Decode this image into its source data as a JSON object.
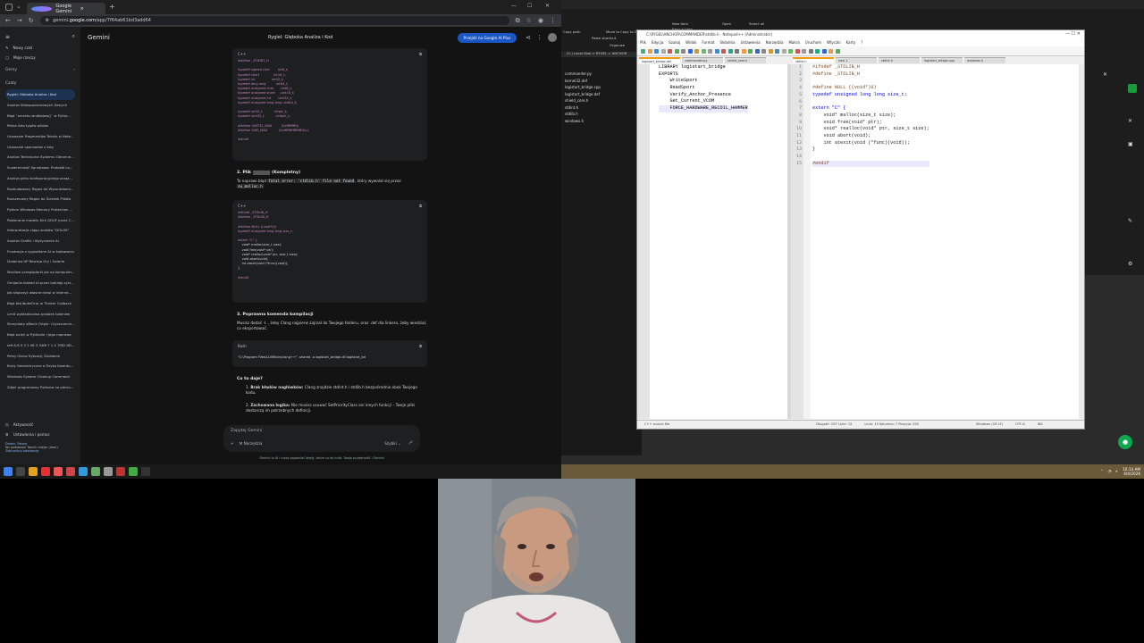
{
  "browser": {
    "tab_title": "Google Gemini",
    "url_plain": "gemini.",
    "url_bold": "google.com",
    "url_rest": "/app/7f64ab61bd3add64"
  },
  "gemini": {
    "brand": "Gemini",
    "conversation_title": "Ryglel: Głęboka Analiza i Kod",
    "upgrade_label": "Przejdź na Google AI Plus",
    "sidebar": {
      "new_chat": "Nowy czat",
      "my_stuff": "Moje rzeczy",
      "gems_heading": "Gemy",
      "chats_heading": "Czaty",
      "chats": [
        "Ryglel: Głęboka Analiza i Kod",
        "Analiza Wielopoziomowych Danych",
        "Błąd `secrets.randbelow()` w Pytho...",
        "Petna lista typów plików",
        "Usuwanie Fragmentów Tekstu w Note...",
        "Usuwanie sponsorów z listy",
        "Analiza Techniczna Systemu Obronne...",
        "Suwerenność Sprzętowa: Protokół Lo...",
        "Analiza pliku konfiguracyjnego prząż...",
        "Rozbudowany Regex do Wyszukiwani...",
        "Rozszerzony Regex do Ścieżek Plików",
        "Python Windows Memory Protection ...",
        "Pobieranie modelu Kirk GGUF przez C...",
        "Interpretacja ciągu znaków \"DOLOK\"",
        "Analiza Grafiki i Wytyczenie AI",
        "Frustracja z sygnatiami AI w kodowaniu",
        "Drabinka HP Rewizja Gry i Galerie",
        "Możliwe przeglądarki jak na komputer...",
        "Omijanie blokad AI przez lodułęp sysl...",
        "Jak stworzyć własne drzwi w interne...",
        "Błąd AttributeError w Tkinter Callback",
        "Limit wykładnictwa prośbek tokenów",
        "Skrzydlaty xBlock Origin: Czyszczenie...",
        "Błąd wcięć w Pythonie i jego naprawa",
        "Ieft 8-8 9 3 2 06 3 34f8 7 1 4 7f5D 6D...",
        "Pełny Obraz Sytuacji, Działanie",
        "Bryły Geometryczne a Fizyka Kwantu...",
        "Windows System Cleanup Command",
        "Zdjęć programowy Pythona na plecia..."
      ],
      "activity": "Aktywność",
      "settings": "Ustawienia i pomoc",
      "location_line1": "Drobin, Polska",
      "location_line2": "Na podstawie Twoich miejsc (dom)",
      "location_line3": "Zaktualizuj lokalizację"
    },
    "code1_lang": "C++",
    "code1_lines": [
      "#define _STDINT_H",
      "",
      "typedef signed char        int8_t;",
      "typedef short              int16_t;",
      "typedef int                int32_t;",
      "typedef long long          int64_t;",
      "typedef unsigned char      uint8_t;",
      "typedef unsigned short     uint16_t;",
      "typedef unsigned int       uint32_t;",
      "typedef unsigned long long uint64_t;",
      "",
      "typedef int32_t            intptr_t;",
      "typedef uint32_t           uintptr_t;",
      "",
      "#define UINT32_MAX         (0xffffffffU)",
      "#define SIZE_MAX           (0xffffffffffffffffULL)",
      "",
      "#endif"
    ],
    "step2_prefix": "2. Plik",
    "step2_suffix": "(Kompletny)",
    "step2_text_a": "To naprawi błąd",
    "step2_code_a": "fatal error: 'stdlib.h' file not found",
    "step2_text_b": ", który wywalał się przez",
    "step2_code_b": "sw_malloc.h",
    "code2_lang": "C++",
    "code2_lines": [
      "#ifndef _STDLIB_H",
      "#define _STDLIB_H",
      "",
      "#define NULL ((void*)0)",
      "typedef unsigned long long size_t;",
      "",
      "extern \"C\" {",
      "    void* malloc(size_t size);",
      "    void free(void* ptr);",
      "    void* realloc(void* ptr, size_t size);",
      "    void abort(void);",
      "    int atexit(void (*func)(void));",
      "}",
      "",
      "#endif"
    ],
    "step3_heading": "3. Poprawna komenda kompilacji",
    "step3_text": "Musisz dodać -I. , żeby Clang najpierw zajrzał do Twojego folderu, oraz .def dla linkera, żeby wiedział, co eksportować.",
    "code3_lang": "Bash",
    "code3_line": "\"C:\\Program Files\\LLVM\\bin\\clang++\" -shared -o logistart_bridge.dll logistart_bri",
    "result_heading": "Co to daje?",
    "result_1_bold": "Brak błędów nagłówków:",
    "result_1_text": " Clang znajdzie stdint.h i stdlib.h bezpośrednio obok Twojego kodu.",
    "result_2_bold": "Zachowana logika:",
    "result_2_text": " Nie musisz usuwać SetPriorityClass ani innych funkcji – Twoje pliki dostarczą im potrzebnych definicji.",
    "prompt_placeholder": "Zapytaj Gemini",
    "tools_label": "Narzędzia",
    "mode_label": "Szybki",
    "disclaimer": "Gemini to AI i może popełniać błędy, także co do ludzi. Twoja prywatność i Gemini"
  },
  "explorer": {
    "buttons": [
      "Copy path",
      "Paste shortcut",
      "Move to",
      "Copy to",
      "Delete",
      "Rename",
      "New item",
      "Easy access",
      "Open",
      "Select all"
    ],
    "group_label": "Organize",
    "path": "(C:) Local Disk  >  RYGEL  >  ANCHOR",
    "files": [
      "commander.py",
      "kernel32.def",
      "logistart_bridge.cpp",
      "logistart_bridge.def",
      "shield_core.h",
      "stdint.h",
      "stdlib.h",
      "windows.h"
    ]
  },
  "notepadpp": {
    "title": "C:\\RYGEL\\ANCHOR\\COMMANDER\\stdlib.h - Notepad++ [Administrator]",
    "menu": [
      "Plik",
      "Edycja",
      "Szukaj",
      "Widok",
      "Format",
      "Składnia",
      "Ustawienia",
      "Narzędzia",
      "Makra",
      "Uruchom",
      "Wtyczki",
      "Karty",
      "?"
    ],
    "left_tabs": [
      "logistart_bridge.def",
      "commander.py",
      "shield_core.h"
    ],
    "right_tabs": [
      "stdlib.h",
      "new 1",
      "stdint.h",
      "logistart_bridge.cpp",
      "windows.h"
    ],
    "def_lines": [
      "LIBRARY logistart_bridge",
      "EXPORTS",
      "    WriteSport",
      "    ReadSport",
      "    Verify_Anchor_Presence",
      "    Get_Current_VCOM",
      "    FORCE_HARDWARE_RECOIL_HAMMER"
    ],
    "h_lines": [
      "#ifndef _STDLIB_H",
      "#define _STDLIB_H",
      "",
      "#define NULL ((void*)0)",
      "typedef unsigned long long size_t;",
      "",
      "extern \"C\" {",
      "    void* malloc(size_t size);",
      "    void free(void* ptr);",
      "    void* realloc(void* ptr, size_t size);",
      "    void abort(void);",
      "    int atexit(void (*func)(void));",
      "}",
      "",
      "#endif"
    ],
    "line_numbers": [
      "1",
      "2",
      "3",
      "4",
      "5",
      "6",
      "7",
      "8",
      "9",
      "10",
      "11",
      "12",
      "13",
      "14",
      "15"
    ],
    "status_left": "C++ source file",
    "status_length": "Długość: 297   Linie: 15",
    "status_pos": "Linia: 15   Kolumna: 7   Pozycja: 292",
    "status_eol": "Windows (CR LF)",
    "status_enc": "UTF-8",
    "status_mode": "INS"
  },
  "taskbar": {
    "time": "10:14 AM",
    "date": "4/4/2026"
  },
  "colors": {
    "gemini_bg": "#131314",
    "accent_blue": "#1a56c4",
    "npp_keyword": "#0000e0",
    "npp_preproc": "#8b4513"
  }
}
